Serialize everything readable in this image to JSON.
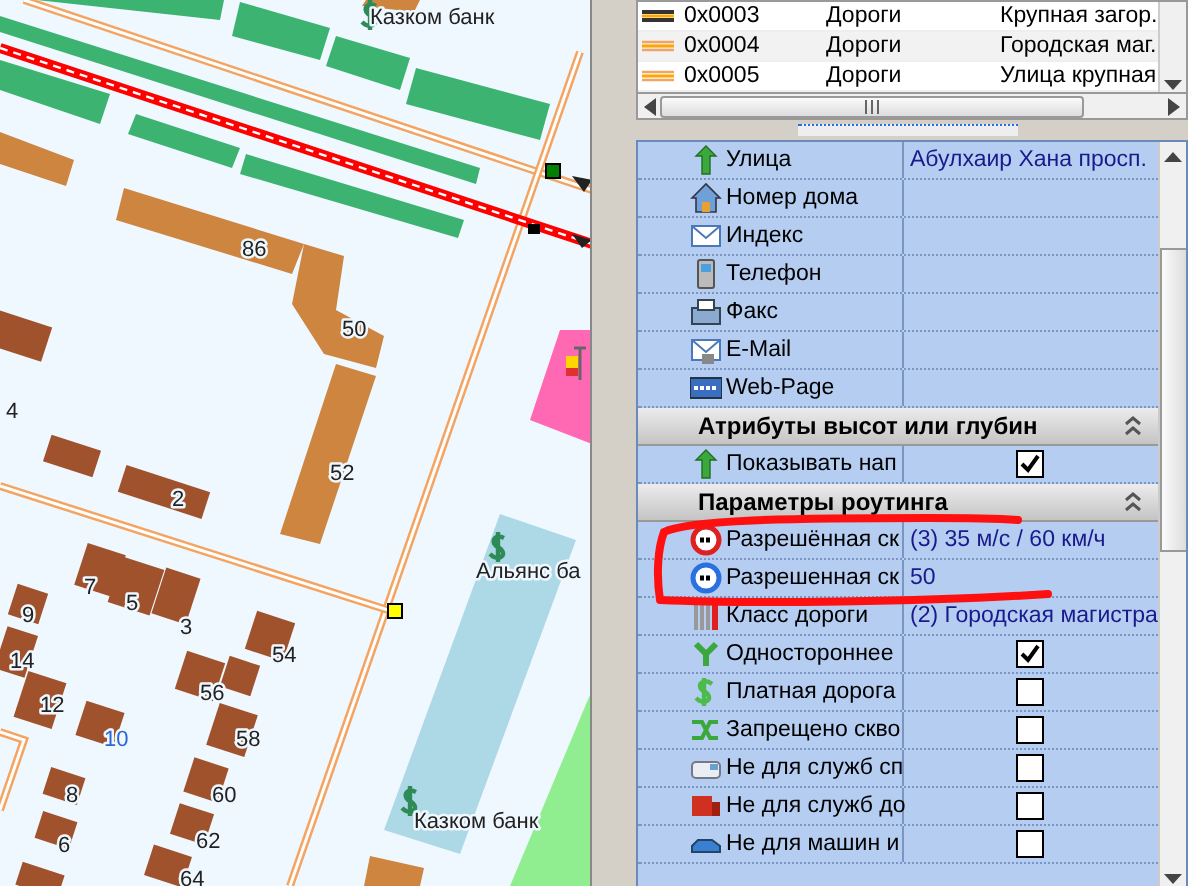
{
  "map": {
    "labels": [
      "Казком банк",
      "86",
      "50",
      "4",
      "52",
      "2",
      "Альянс ба",
      "7",
      "5",
      "9",
      "3",
      "14",
      "54",
      "56",
      "12",
      "58",
      "10",
      "8",
      "60",
      "6",
      "62",
      "64",
      "Казком банк"
    ]
  },
  "object_table": {
    "rows": [
      {
        "code": "0x0003",
        "type": "Дороги",
        "name": "Крупная загор."
      },
      {
        "code": "0x0004",
        "type": "Дороги",
        "name": "Городская маг."
      },
      {
        "code": "0x0005",
        "type": "Дороги",
        "name": "Улица крупная"
      }
    ]
  },
  "property_grid": {
    "rows": [
      {
        "kind": "field",
        "label": "Улица",
        "value": "Абулхаир Хана просп."
      },
      {
        "kind": "field",
        "label": "Номер дома"
      },
      {
        "kind": "field",
        "label": "Индекс"
      },
      {
        "kind": "field",
        "label": "Телефон"
      },
      {
        "kind": "field",
        "label": "Факс"
      },
      {
        "kind": "field",
        "label": "E-Mail"
      },
      {
        "kind": "field",
        "label": "Web-Page"
      },
      {
        "kind": "section",
        "label": "Атрибуты высот или глубин",
        "expanded": true
      },
      {
        "kind": "check",
        "label": "Показывать нап",
        "checked": true
      },
      {
        "kind": "section",
        "label": "Параметры роутинга",
        "expanded": true
      },
      {
        "kind": "field",
        "label": "Разрешённая ск",
        "value": "(3) 35 м/с / 60 км/ч"
      },
      {
        "kind": "field",
        "label": "Разрешенная ск",
        "value": "50"
      },
      {
        "kind": "field",
        "label": "Класс дороги",
        "value": "(2) Городская магистра"
      },
      {
        "kind": "check",
        "label": "Одностороннее",
        "checked": true
      },
      {
        "kind": "check",
        "label": "Платная дорога",
        "checked": false
      },
      {
        "kind": "check",
        "label": "Запрещено скво",
        "checked": false
      },
      {
        "kind": "check",
        "label": "Не для служб сп",
        "checked": false
      },
      {
        "kind": "check",
        "label": "Не для служб до",
        "checked": false
      },
      {
        "kind": "check",
        "label": "Не для машин и",
        "checked": false
      }
    ]
  }
}
